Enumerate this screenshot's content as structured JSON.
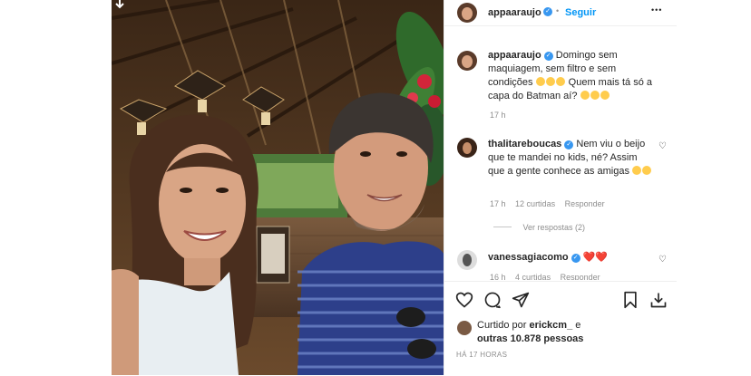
{
  "post": {
    "username": "appaaraujo",
    "follow_label": "Seguir",
    "more_label": "•••",
    "caption_user": "appaaraujo",
    "caption_text": "Domingo sem maquiagem, sem filtro e sem condições",
    "caption_text2": "Quem mais tá só a capa do Batman aí?",
    "caption_time": "17 h"
  },
  "comments": [
    {
      "user": "thalitareboucas",
      "text": "Nem viu o beijo que te mandei no kids, né? Assim que a gente conhece as amigas",
      "time": "17 h",
      "likes": "12 curtidas",
      "reply": "Responder",
      "view_replies": "Ver respostas (2)"
    },
    {
      "user": "vanessagiacomo",
      "hearts": "❤️❤️",
      "time": "16 h",
      "likes": "4 curtidas",
      "reply": "Responder"
    }
  ],
  "actions": {
    "liked_by_prefix": "Curtido por",
    "liked_by_user": "erickcm_",
    "liked_by_and": "e",
    "liked_by_others": "outras 10.878 pessoas",
    "timestamp": "HÁ 17 HORAS"
  },
  "colors": {
    "accent": "#0095f6",
    "verified": "#3897f0",
    "meta": "#8e8e8e",
    "heart": "#ed4956"
  }
}
